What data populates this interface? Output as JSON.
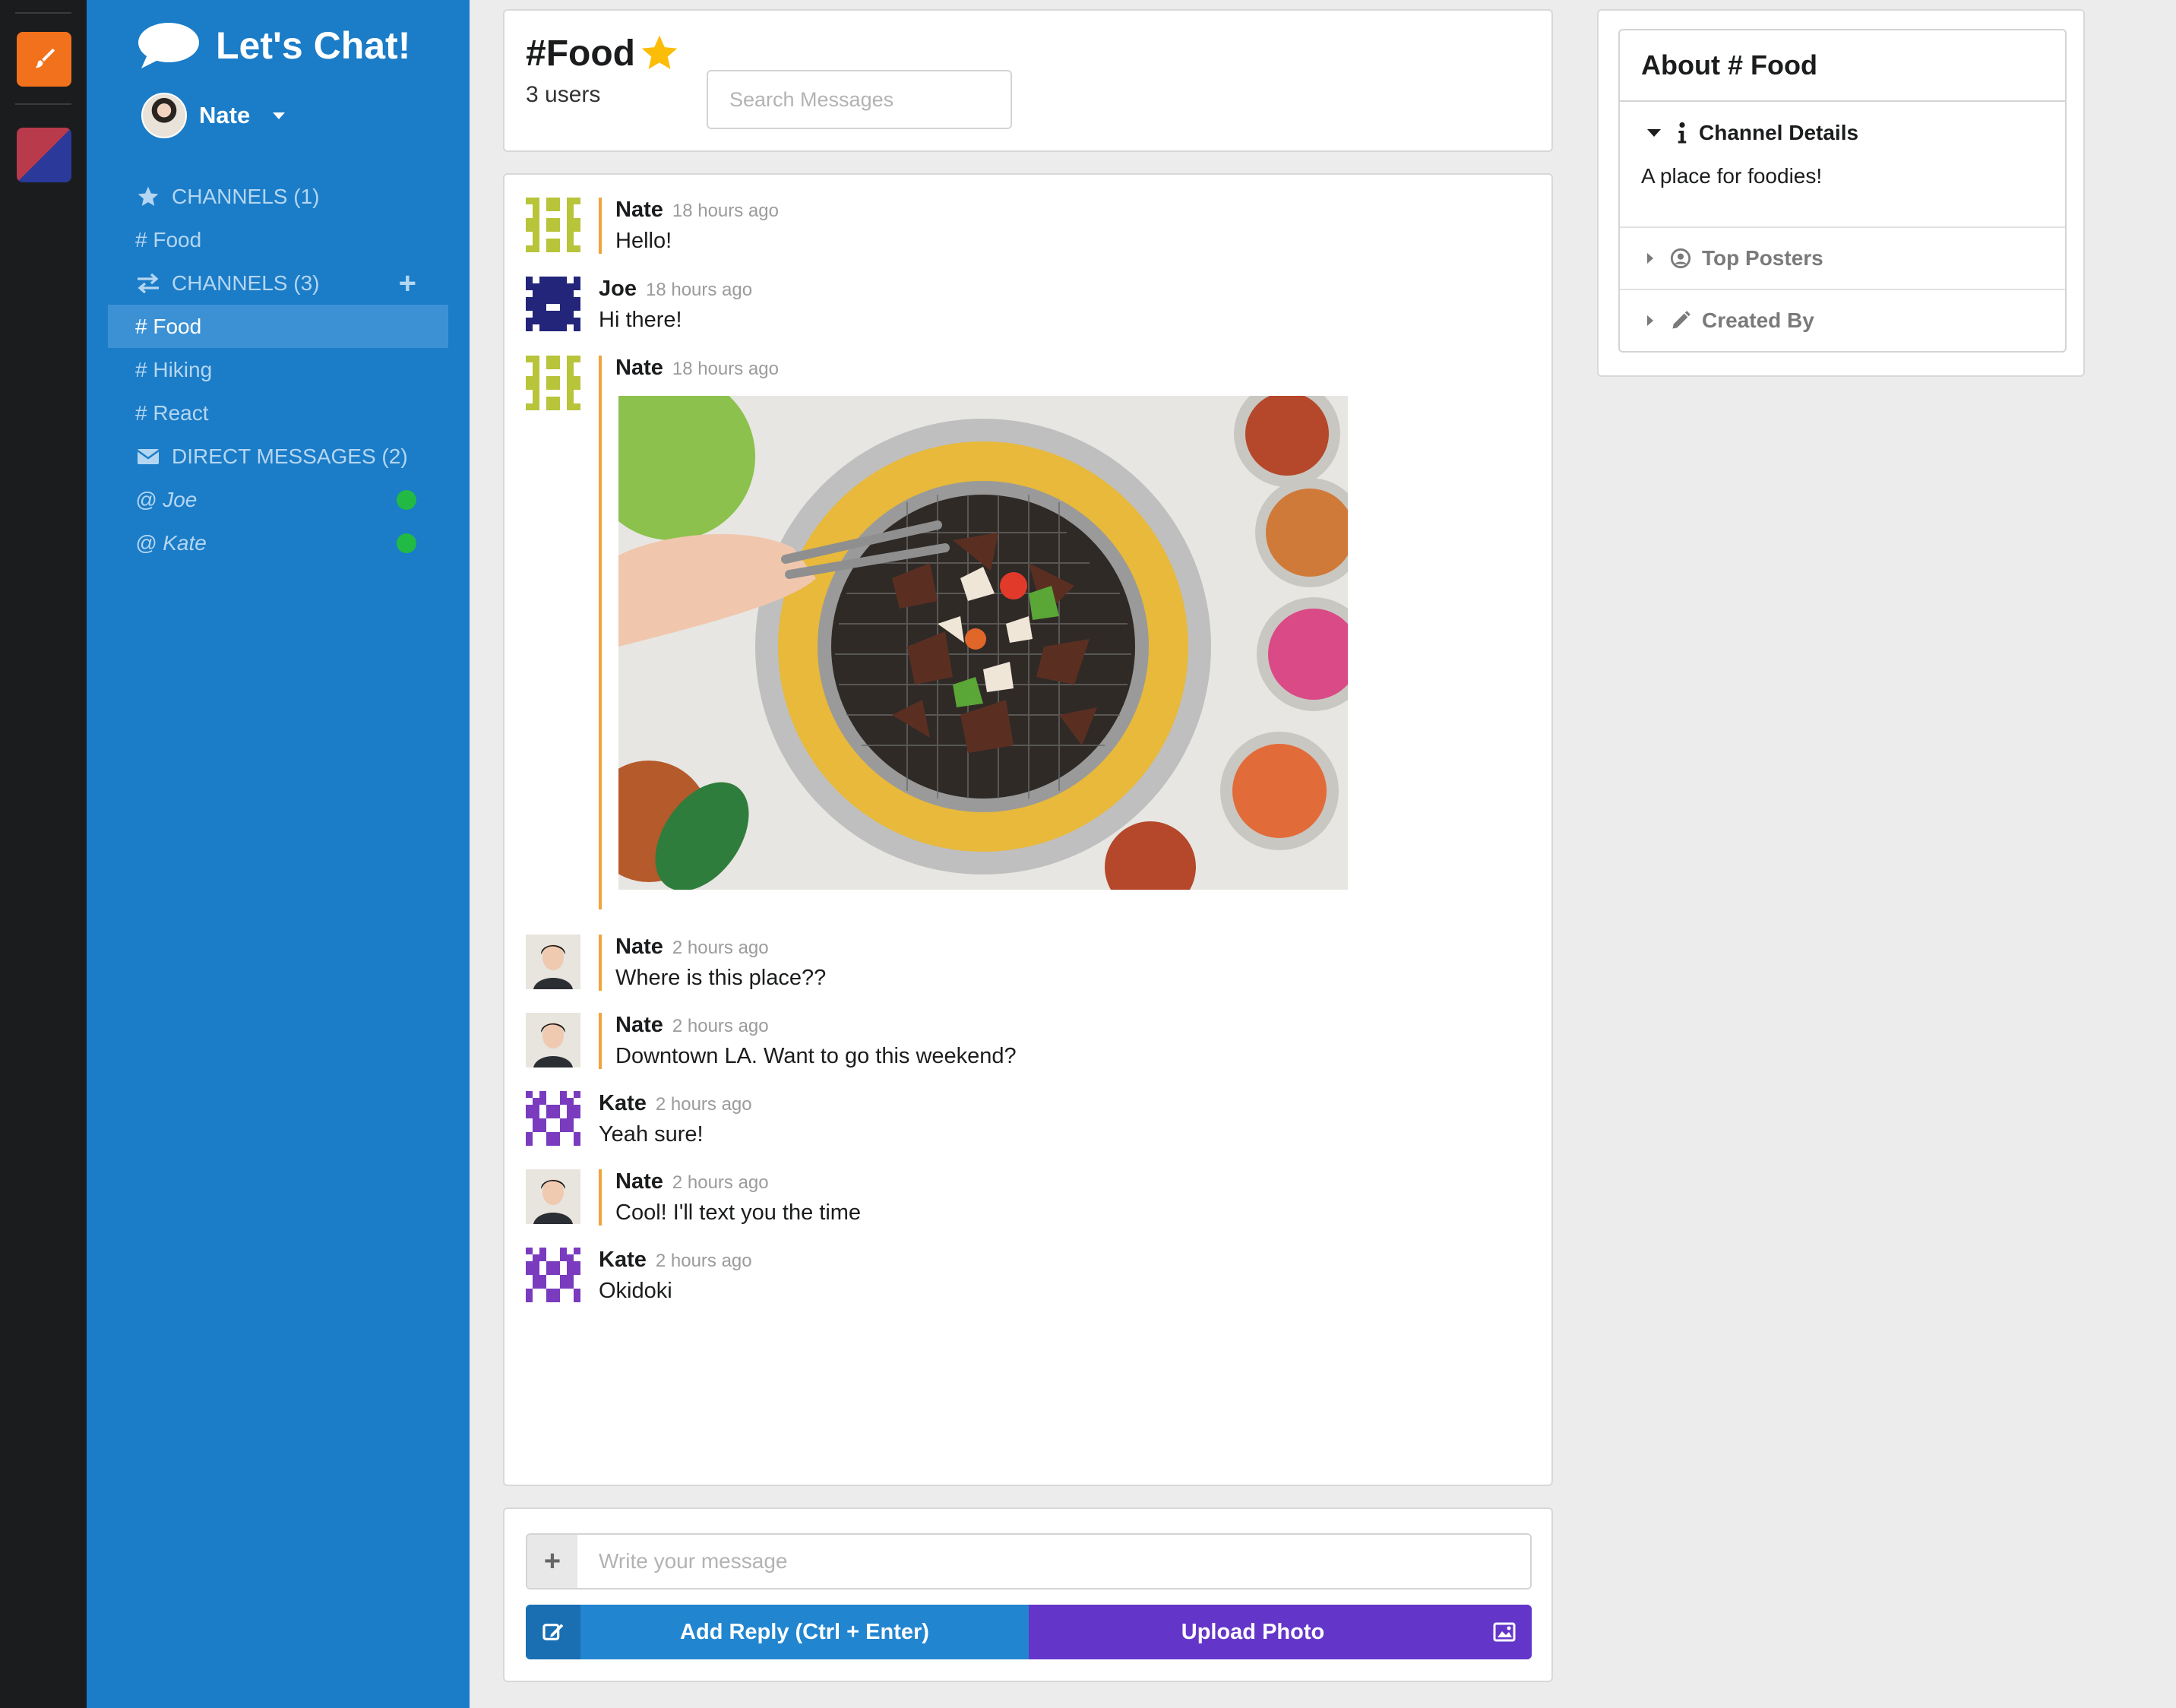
{
  "app": {
    "brand": "Let's Chat!",
    "current_user": "Nate"
  },
  "sidebar": {
    "starred_header": "CHANNELS (1)",
    "starred_items": [
      "# Food"
    ],
    "channels_header": "CHANNELS (3)",
    "channels": [
      "# Food",
      "# Hiking",
      "# React"
    ],
    "active_channel": "# Food",
    "dm_header": "DIRECT MESSAGES (2)",
    "dms": [
      {
        "label": "@ Joe",
        "online": true
      },
      {
        "label": "@ Kate",
        "online": true
      }
    ]
  },
  "channel": {
    "name": "#Food",
    "user_count": "3 users",
    "starred": true
  },
  "search": {
    "placeholder": "Search Messages"
  },
  "messages": [
    {
      "author": "Nate",
      "time": "18 hours ago",
      "text": "Hello!",
      "avatar": "identicon-olive"
    },
    {
      "author": "Joe",
      "time": "18 hours ago",
      "text": "Hi there!",
      "avatar": "identicon-navy"
    },
    {
      "author": "Nate",
      "time": "18 hours ago",
      "text": "",
      "avatar": "identicon-olive",
      "image": "korean-bbq-grill-photo"
    },
    {
      "author": "Nate",
      "time": "2 hours ago",
      "text": "Where is this place??",
      "avatar": "photo-nate"
    },
    {
      "author": "Nate",
      "time": "2 hours ago",
      "text": "Downtown LA. Want to go this weekend?",
      "avatar": "photo-nate"
    },
    {
      "author": "Kate",
      "time": "2 hours ago",
      "text": "Yeah sure!",
      "avatar": "identicon-purple"
    },
    {
      "author": "Nate",
      "time": "2 hours ago",
      "text": "Cool! I'll text you the time",
      "avatar": "photo-nate"
    },
    {
      "author": "Kate",
      "time": "2 hours ago",
      "text": "Okidoki",
      "avatar": "identicon-purple"
    }
  ],
  "composer": {
    "placeholder": "Write your message",
    "reply_label": "Add Reply (Ctrl + Enter)",
    "upload_label": "Upload Photo"
  },
  "about": {
    "title": "About # Food",
    "details_label": "Channel Details",
    "description": "A place for foodies!",
    "top_posters_label": "Top Posters",
    "created_by_label": "Created By"
  },
  "colors": {
    "sidebar_bg": "#1b7cc7",
    "active_item": "#3c91d4",
    "reply_button": "#2185d0",
    "upload_button": "#6435c9",
    "message_bar": "#f2a33a",
    "star": "#fbbd08",
    "presence": "#21ba45"
  }
}
